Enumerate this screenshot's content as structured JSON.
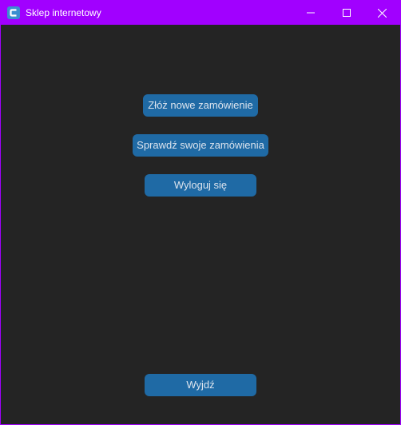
{
  "window": {
    "title": "Sklep internetowy",
    "app_icon": "app-logo-icon",
    "controls": {
      "minimize_icon": "minimize-icon",
      "maximize_icon": "maximize-icon",
      "close_icon": "close-icon"
    }
  },
  "colors": {
    "titlebar": "#a100ff",
    "background": "#242424",
    "button": "#1f6aa5",
    "button_text": "#dce4ee"
  },
  "menu": {
    "new_order_label": "Złóż nowe zamówienie",
    "check_orders_label": "Sprawdź swoje zamówienia",
    "logout_label": "Wyloguj się",
    "exit_label": "Wyjdź"
  }
}
